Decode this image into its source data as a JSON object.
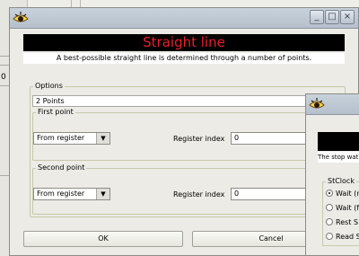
{
  "background": {
    "left_value": "0"
  },
  "main_dialog": {
    "banner_title": "Straight line",
    "subtitle": "A best-possible straight line is determined through a number of points.",
    "options_legend": "Options",
    "points_mode": "2 Points",
    "first_point": {
      "legend": "First point",
      "source_value": "From register",
      "index_label": "Register index",
      "index_value": "0"
    },
    "second_point": {
      "legend": "Second point",
      "source_value": "From register",
      "index_label": "Register index",
      "index_value": "0"
    },
    "ok_label": "OK",
    "cancel_label": "Cancel"
  },
  "second_dialog": {
    "subtitle": "The stop wat",
    "group_legend": "StClock",
    "options": [
      {
        "label": "Wait (r",
        "selected": true
      },
      {
        "label": "Wait (f",
        "selected": false
      },
      {
        "label": "Rest S",
        "selected": false
      },
      {
        "label": "Read S",
        "selected": false
      }
    ]
  },
  "colors": {
    "banner_bg": "#000000",
    "banner_text": "#e8202a",
    "dialog_bg": "#ecebe6",
    "titlebar": "#c0cad4"
  }
}
